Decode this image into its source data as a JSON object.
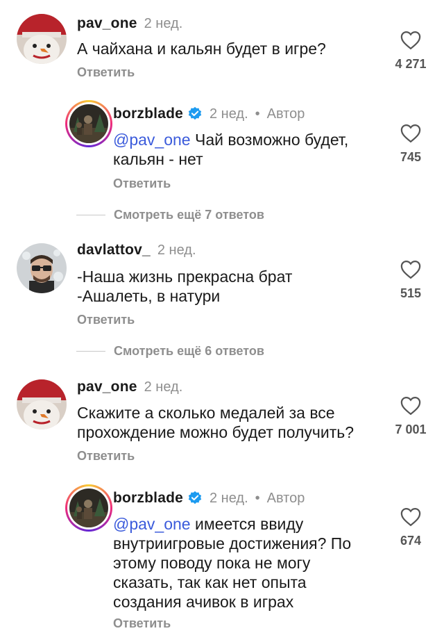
{
  "comments": [
    {
      "username": "pav_one",
      "time": "2 нед.",
      "text": "А чайхана и кальян будет в игре?",
      "reply_label": "Ответить",
      "likes": "4 271"
    },
    {
      "username": "borzblade",
      "time": "2 нед.",
      "author_label": "Автор",
      "mention": "@pav_one",
      "text": " Чай возможно будет,\nкальян - нет",
      "reply_label": "Ответить",
      "likes": "745"
    },
    {
      "more_replies": "Смотреть ещё 7 ответов"
    },
    {
      "username": "davlattov_",
      "time": "2 нед.",
      "text": "-Наша жизнь прекрасна брат\n-Ашалеть, в натури",
      "reply_label": "Ответить",
      "likes": "515"
    },
    {
      "more_replies": "Смотреть ещё 6 ответов"
    },
    {
      "username": "pav_one",
      "time": "2 нед.",
      "text": "Скажите а сколько медалей за все\nпрохождение можно будет получить?",
      "reply_label": "Ответить",
      "likes": "7 001"
    },
    {
      "username": "borzblade",
      "time": "2 нед.",
      "author_label": "Автор",
      "mention": "@pav_one",
      "text": " имеется ввиду\nвнутриигровые достижения? По\nэтому поводу пока не могу\nсказать, так как нет опыта\nсоздания ачивок в играх",
      "reply_label": "Ответить",
      "likes": "674"
    }
  ],
  "colors": {
    "mention": "#3b5bdb",
    "verified": "#1d9bf0",
    "secondary_text": "#8e8e8e"
  },
  "icons": [
    "heart-icon",
    "verified-badge-icon",
    "avatar-snowman",
    "avatar-glasses-man",
    "avatar-borzblade"
  ]
}
